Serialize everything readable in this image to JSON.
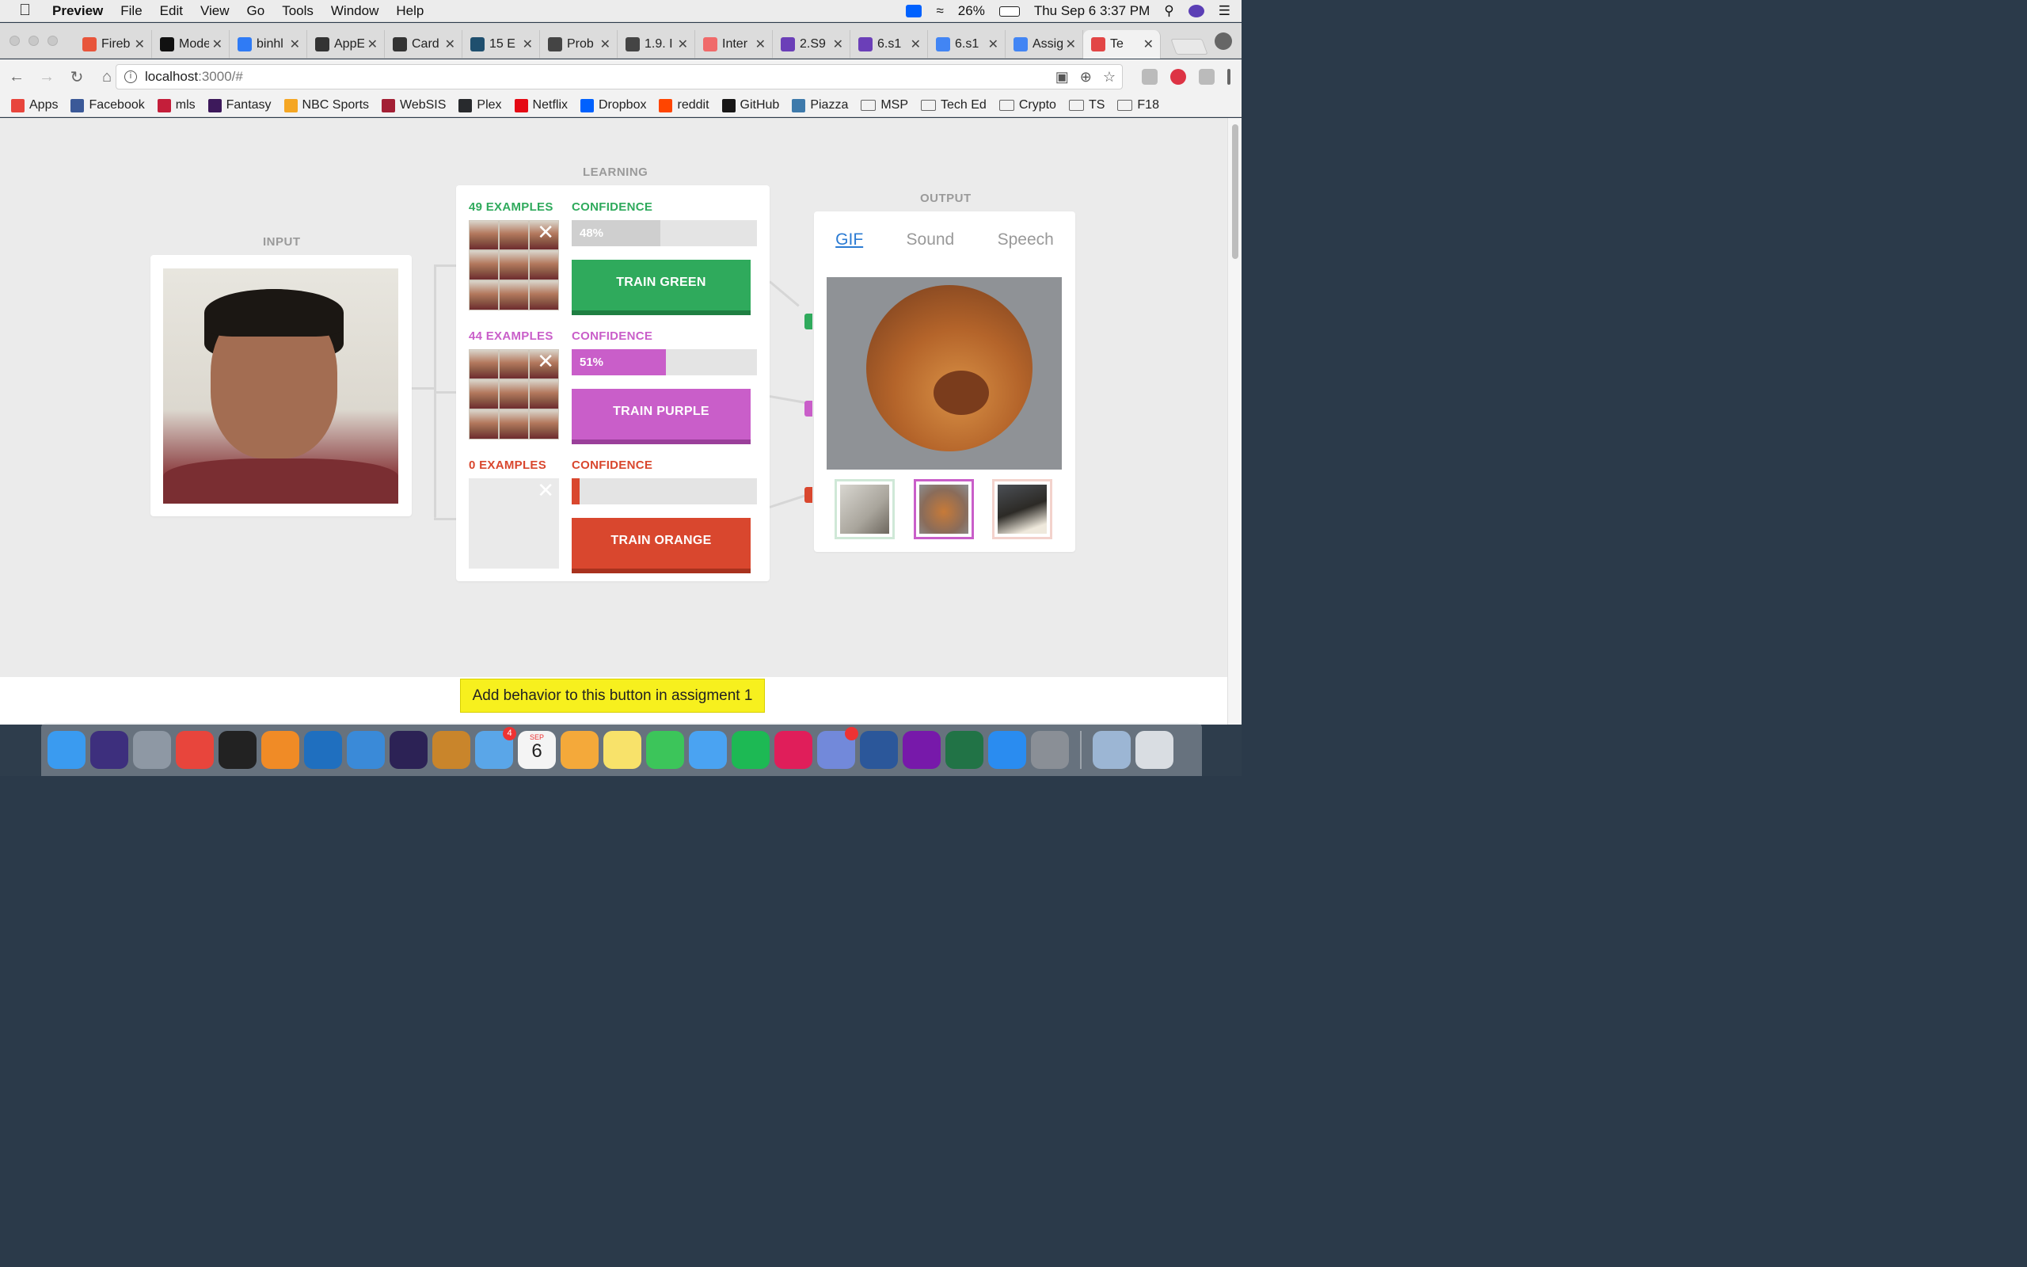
{
  "menubar": {
    "app_name": "Preview",
    "items": [
      "File",
      "Edit",
      "View",
      "Go",
      "Tools",
      "Window",
      "Help"
    ],
    "battery": "26%",
    "datetime": "Thu Sep 6  3:37 PM"
  },
  "tabs": [
    {
      "title": "Fireb",
      "color": "#e8553b"
    },
    {
      "title": "Mode",
      "color": "#111111"
    },
    {
      "title": "binhl",
      "color": "#2f7bf5"
    },
    {
      "title": "AppE",
      "color": "#333333"
    },
    {
      "title": "Card",
      "color": "#333333"
    },
    {
      "title": "15 E",
      "color": "#1f4f6e"
    },
    {
      "title": "Prob",
      "color": "#444444"
    },
    {
      "title": "1.9. I",
      "color": "#444444"
    },
    {
      "title": "Inter",
      "color": "#f06a6a"
    },
    {
      "title": "2.S9",
      "color": "#6b3fb8"
    },
    {
      "title": "6.s1",
      "color": "#6b3fb8"
    },
    {
      "title": "6.s1",
      "color": "#4285f4"
    },
    {
      "title": "Assig",
      "color": "#4285f4"
    },
    {
      "title": "Te",
      "color": "#e24646"
    }
  ],
  "address": {
    "host": "localhost",
    "path": ":3000/#"
  },
  "bookmarks": [
    {
      "label": "Apps",
      "color": "#e8453c",
      "type": "icon"
    },
    {
      "label": "Facebook",
      "color": "#3b5998",
      "type": "icon"
    },
    {
      "label": "mls",
      "color": "#c41e3a",
      "type": "icon"
    },
    {
      "label": "Fantasy",
      "color": "#3d195b",
      "type": "icon"
    },
    {
      "label": "NBC Sports",
      "color": "#f5a623",
      "type": "icon"
    },
    {
      "label": "WebSIS",
      "color": "#a31f34",
      "type": "icon"
    },
    {
      "label": "Plex",
      "color": "#282a2d",
      "type": "icon"
    },
    {
      "label": "Netflix",
      "color": "#e50914",
      "type": "icon"
    },
    {
      "label": "Dropbox",
      "color": "#0061fe",
      "type": "icon"
    },
    {
      "label": "reddit",
      "color": "#ff4500",
      "type": "icon"
    },
    {
      "label": "GitHub",
      "color": "#181717",
      "type": "icon"
    },
    {
      "label": "Piazza",
      "color": "#3e7aab",
      "type": "icon"
    },
    {
      "label": "MSP",
      "type": "folder"
    },
    {
      "label": "Tech Ed",
      "type": "folder"
    },
    {
      "label": "Crypto",
      "type": "folder"
    },
    {
      "label": "TS",
      "type": "folder"
    },
    {
      "label": "F18",
      "type": "folder"
    }
  ],
  "sections": {
    "input": "INPUT",
    "learning": "LEARNING",
    "output": "OUTPUT"
  },
  "classes": [
    {
      "examples": "49 EXAMPLES",
      "confidence_label": "CONFIDENCE",
      "confidence": 0.48,
      "confidence_text": "48%",
      "button": "TRAIN GREEN",
      "color": "#2faa5c",
      "bar_color": "#cfcfcf",
      "shade": "#1f7f42"
    },
    {
      "examples": "44 EXAMPLES",
      "confidence_label": "CONFIDENCE",
      "confidence": 0.51,
      "confidence_text": "51%",
      "button": "TRAIN PURPLE",
      "color": "#c95ec9",
      "bar_color": "#c95ec9",
      "shade": "#9a3f9a"
    },
    {
      "examples": "0 EXAMPLES",
      "confidence_label": "CONFIDENCE",
      "confidence": 0,
      "confidence_text": "",
      "button": "TRAIN ORANGE",
      "color": "#d9472e",
      "bar_color": "#d9472e",
      "shade": "#a8321e"
    }
  ],
  "output": {
    "tabs": [
      "GIF",
      "Sound",
      "Speech"
    ],
    "active_tab": "GIF",
    "thumb_borders": [
      "#cfe8d7",
      "#c95ec9",
      "#f3d2cc"
    ]
  },
  "assignment_button": "Add behavior to this button in assigment 1",
  "dock": {
    "apps": [
      {
        "name": "finder",
        "color": "#3a9bf0"
      },
      {
        "name": "siri",
        "color": "#3d2f7d"
      },
      {
        "name": "launchpad",
        "color": "#8e98a4"
      },
      {
        "name": "chrome",
        "color": "#e8453c"
      },
      {
        "name": "terminal",
        "color": "#222222"
      },
      {
        "name": "sublime",
        "color": "#f08b26"
      },
      {
        "name": "vscode",
        "color": "#1f6fbf"
      },
      {
        "name": "xcode",
        "color": "#3a8ad8"
      },
      {
        "name": "eclipse",
        "color": "#2c2255"
      },
      {
        "name": "cyberduck",
        "color": "#c9852b"
      },
      {
        "name": "mail",
        "color": "#5aa6e8",
        "badge": "4"
      },
      {
        "name": "calendar",
        "color": "#f4f4f4"
      },
      {
        "name": "photos",
        "color": "#f4a93a"
      },
      {
        "name": "notes",
        "color": "#f8e26a"
      },
      {
        "name": "facetime",
        "color": "#3cc55a"
      },
      {
        "name": "messages",
        "color": "#4aa3f2"
      },
      {
        "name": "spotify",
        "color": "#1db954"
      },
      {
        "name": "slack",
        "color": "#e01e5a"
      },
      {
        "name": "discord",
        "color": "#7289da",
        "badge": ""
      },
      {
        "name": "word",
        "color": "#2b579a"
      },
      {
        "name": "onenote",
        "color": "#7719aa"
      },
      {
        "name": "excel",
        "color": "#217346"
      },
      {
        "name": "app-store",
        "color": "#2a8cf0"
      },
      {
        "name": "system-preferences",
        "color": "#8a8f96"
      },
      {
        "name": "preview",
        "color": "#9cb6d4"
      }
    ],
    "calendar_month": "SEP",
    "calendar_day": "6"
  }
}
